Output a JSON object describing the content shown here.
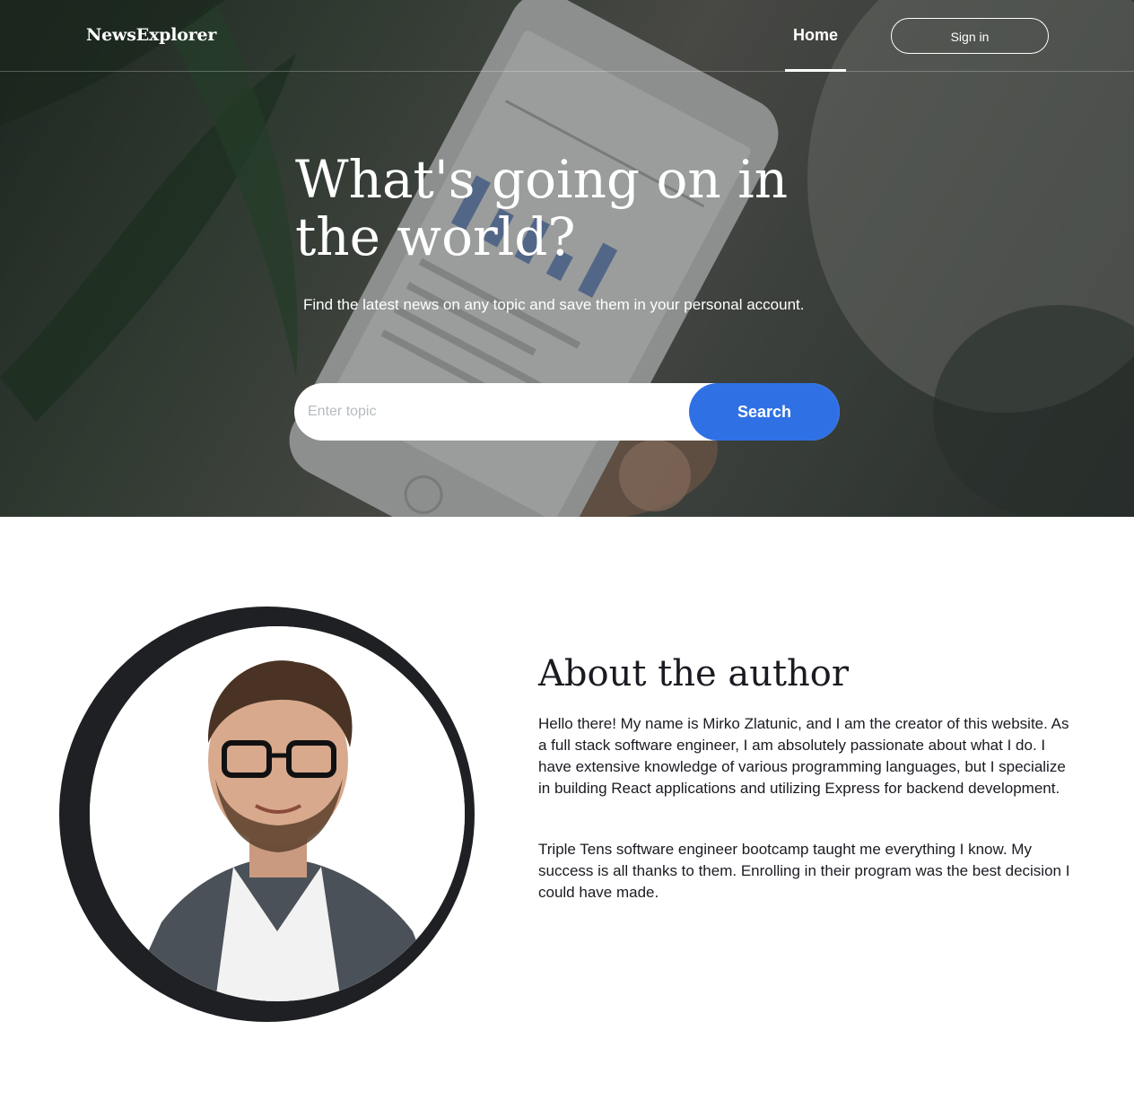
{
  "header": {
    "logo": "NewsExplorer",
    "nav_home": "Home",
    "signin_label": "Sign in"
  },
  "hero": {
    "title": "What's going on in the world?",
    "subtitle": "Find the latest news on any topic and save them in your personal account.",
    "search_placeholder": "Enter topic",
    "search_button": "Search"
  },
  "about": {
    "title": "About the author",
    "paragraph1": "Hello there! My name is Mirko Zlatunic, and I am the creator of this website. As a full stack software engineer, I am absolutely passionate about what I do. I have extensive knowledge of various programming languages, but I specialize in building React applications and utilizing Express for backend development.",
    "paragraph2": "Triple Tens software engineer bootcamp taught me everything I know. My success is all thanks to them. Enrolling in their program was the best decision I could have made."
  },
  "colors": {
    "accent": "#2f71e5",
    "text": "#1a1b22",
    "avatar_ring": "#1f2024"
  },
  "icons": {
    "hero_background": "phone-in-hand-photo",
    "author_photo": "author-portrait-photo"
  }
}
